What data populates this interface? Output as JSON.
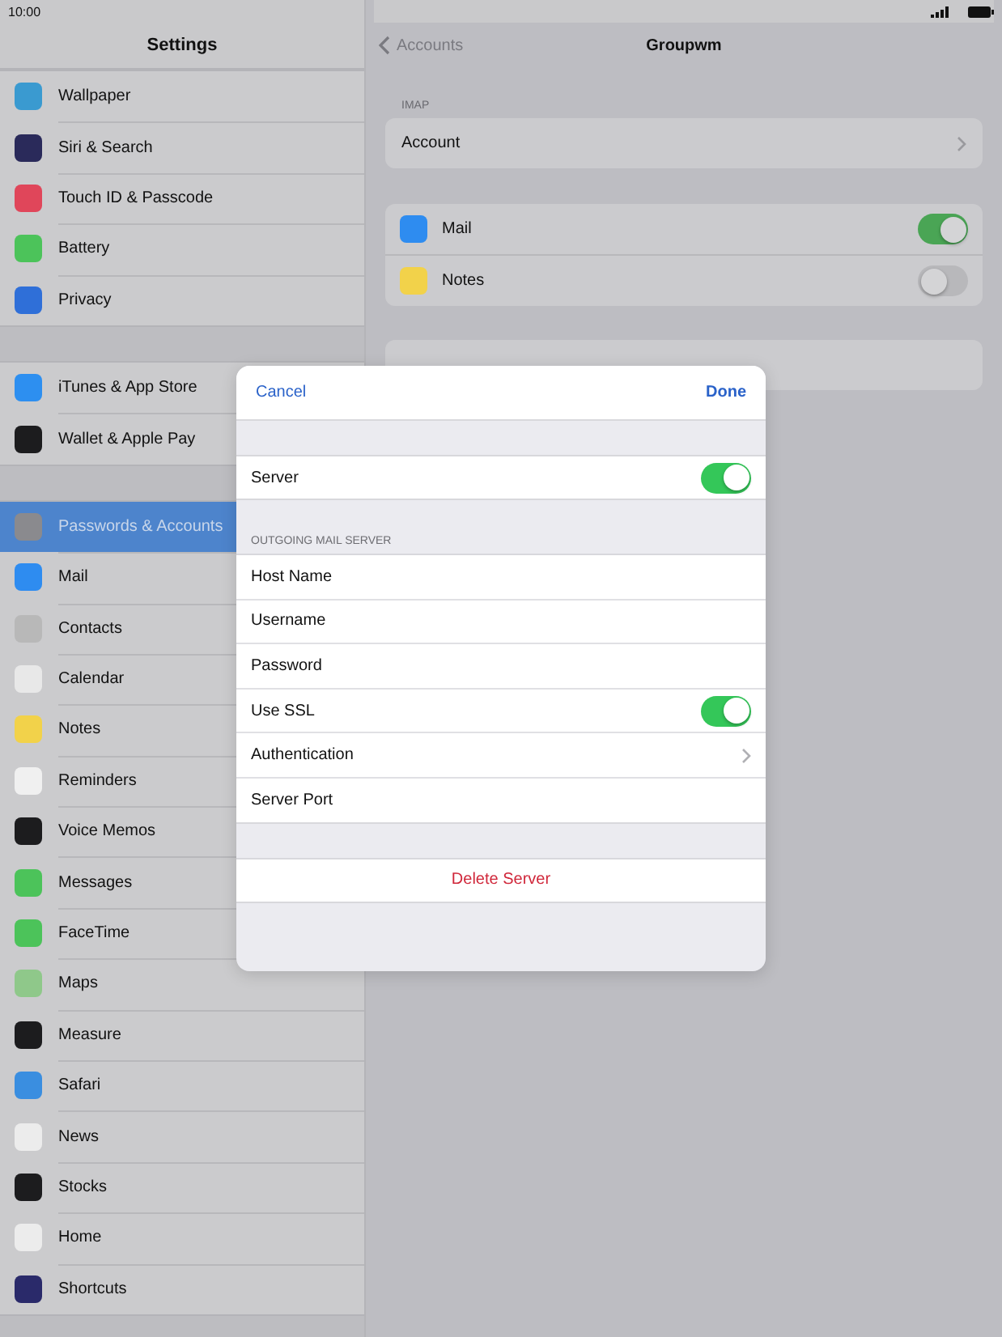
{
  "status_bar": {
    "time": "10:00"
  },
  "sidebar": {
    "title": "Settings",
    "groups": [
      [
        {
          "label": "Wallpaper",
          "color": "#3a9ad0",
          "selected": false
        },
        {
          "label": "Siri & Search",
          "color": "#2a2a5a",
          "selected": false
        },
        {
          "label": "Touch ID & Passcode",
          "color": "#e0465a",
          "selected": false
        },
        {
          "label": "Battery",
          "color": "#4cc35a",
          "selected": false
        },
        {
          "label": "Privacy",
          "color": "#2f6fd8",
          "selected": false
        }
      ],
      [
        {
          "label": "iTunes & App Store",
          "color": "#2d8ff0",
          "selected": false
        },
        {
          "label": "Wallet & Apple Pay",
          "color": "#1c1c1e",
          "selected": false
        }
      ],
      [
        {
          "label": "Passwords & Accounts",
          "color": "#8a8a8e",
          "selected": true
        },
        {
          "label": "Mail",
          "color": "#2e8cf0",
          "selected": false
        },
        {
          "label": "Contacts",
          "color": "#b8b8b8",
          "selected": false
        },
        {
          "label": "Calendar",
          "color": "#e8e8e8",
          "selected": false
        },
        {
          "label": "Notes",
          "color": "#f2d24a",
          "selected": false
        },
        {
          "label": "Reminders",
          "color": "#f0f0f0",
          "selected": false
        },
        {
          "label": "Voice Memos",
          "color": "#1c1c1e",
          "selected": false
        },
        {
          "label": "Messages",
          "color": "#4cc35a",
          "selected": false
        },
        {
          "label": "FaceTime",
          "color": "#4cc35a",
          "selected": false
        },
        {
          "label": "Maps",
          "color": "#8fc88a",
          "selected": false
        },
        {
          "label": "Measure",
          "color": "#1c1c1e",
          "selected": false
        },
        {
          "label": "Safari",
          "color": "#3a8ee0",
          "selected": false
        },
        {
          "label": "News",
          "color": "#ececec",
          "selected": false
        },
        {
          "label": "Stocks",
          "color": "#1c1c1e",
          "selected": false
        },
        {
          "label": "Home",
          "color": "#ececec",
          "selected": false
        },
        {
          "label": "Shortcuts",
          "color": "#2a2a6a",
          "selected": false
        }
      ]
    ]
  },
  "detail": {
    "back": "Accounts",
    "title": "Groupwm",
    "section_label": "IMAP",
    "account_row": "Account",
    "apps": [
      {
        "label": "Mail",
        "color": "#2e8cf0",
        "on": true
      },
      {
        "label": "Notes",
        "color": "#f2d24a",
        "on": false
      }
    ]
  },
  "modal": {
    "cancel": "Cancel",
    "done": "Done",
    "server": {
      "label": "Server",
      "on": true
    },
    "section": "OUTGOING MAIL SERVER",
    "fields": [
      {
        "label": "Host Name",
        "kind": "text"
      },
      {
        "label": "Username",
        "kind": "text"
      },
      {
        "label": "Password",
        "kind": "text"
      },
      {
        "label": "Use SSL",
        "kind": "toggle",
        "on": true
      },
      {
        "label": "Authentication",
        "kind": "chevron"
      },
      {
        "label": "Server Port",
        "kind": "text"
      }
    ],
    "delete": "Delete Server"
  }
}
